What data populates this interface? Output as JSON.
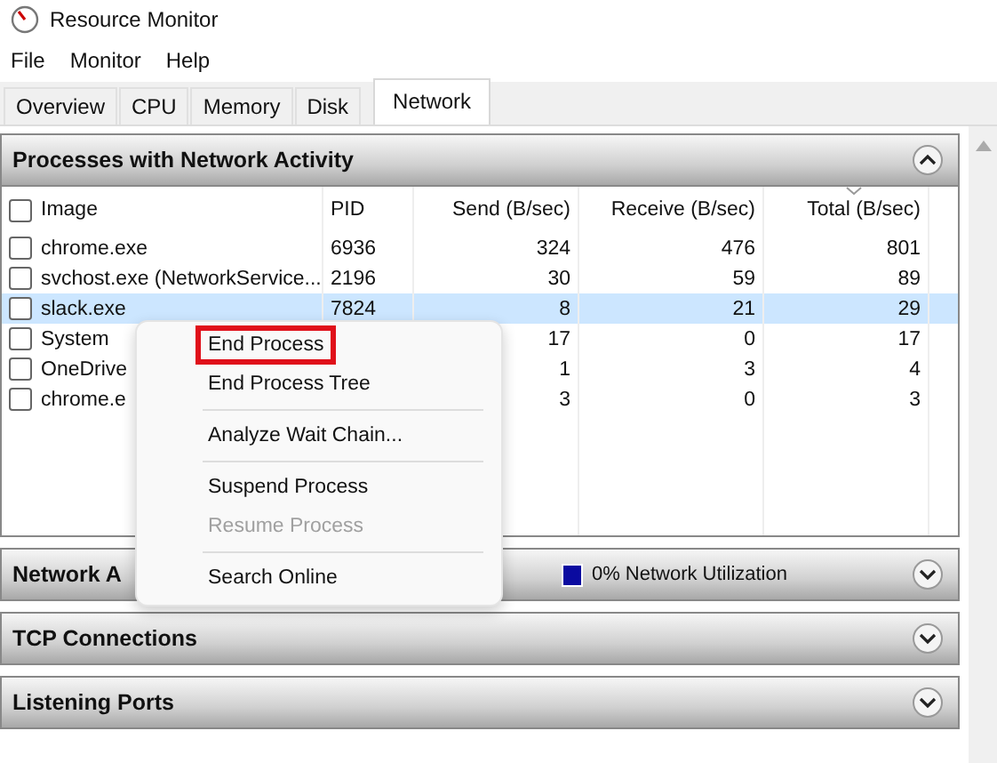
{
  "window": {
    "title": "Resource Monitor"
  },
  "menu": [
    "File",
    "Monitor",
    "Help"
  ],
  "tabs": [
    {
      "label": "Overview",
      "selected": false
    },
    {
      "label": "CPU",
      "selected": false
    },
    {
      "label": "Memory",
      "selected": false
    },
    {
      "label": "Disk",
      "selected": false
    },
    {
      "label": "Network",
      "selected": true
    }
  ],
  "sections": [
    {
      "title": "Processes with Network Activity",
      "expanded": true,
      "table": {
        "all_checked": false,
        "columns": [
          {
            "label": "Image",
            "sorted": false
          },
          {
            "label": "PID",
            "sorted": false
          },
          {
            "label": "Send (B/sec)",
            "sorted": false
          },
          {
            "label": "Receive (B/sec)",
            "sorted": false
          },
          {
            "label": "Total (B/sec)",
            "sorted": true
          }
        ],
        "rows": [
          {
            "checked": false,
            "selected": false,
            "cells": [
              "chrome.exe",
              "6936",
              "324",
              "476",
              "801"
            ]
          },
          {
            "checked": false,
            "selected": false,
            "cells": [
              "svchost.exe (NetworkService...",
              "2196",
              "30",
              "59",
              "89"
            ]
          },
          {
            "checked": false,
            "selected": true,
            "cells": [
              "slack.exe",
              "7824",
              "8",
              "21",
              "29"
            ]
          },
          {
            "checked": false,
            "selected": false,
            "cells": [
              "System",
              "",
              "17",
              "0",
              "17"
            ]
          },
          {
            "checked": false,
            "selected": false,
            "cells": [
              "OneDrive",
              "",
              "1",
              "3",
              "4"
            ]
          },
          {
            "checked": false,
            "selected": false,
            "cells": [
              "chrome.e",
              "",
              "3",
              "0",
              "3"
            ]
          }
        ]
      }
    },
    {
      "title": "Network A",
      "expanded": false,
      "status": "0% Network Utilization"
    },
    {
      "title": "TCP Connections",
      "expanded": false
    },
    {
      "title": "Listening Ports",
      "expanded": false
    }
  ],
  "context_menu": [
    {
      "kind": "item",
      "label": "End Process",
      "disabled": false,
      "highlighted": true
    },
    {
      "kind": "item",
      "label": "End Process Tree",
      "disabled": false,
      "highlighted": false
    },
    {
      "kind": "separator"
    },
    {
      "kind": "item",
      "label": "Analyze Wait Chain...",
      "disabled": false,
      "highlighted": false
    },
    {
      "kind": "separator"
    },
    {
      "kind": "item",
      "label": "Suspend Process",
      "disabled": false,
      "highlighted": false
    },
    {
      "kind": "item",
      "label": "Resume Process",
      "disabled": true,
      "highlighted": false
    },
    {
      "kind": "separator"
    },
    {
      "kind": "item",
      "label": "Search Online",
      "disabled": false,
      "highlighted": false
    }
  ]
}
